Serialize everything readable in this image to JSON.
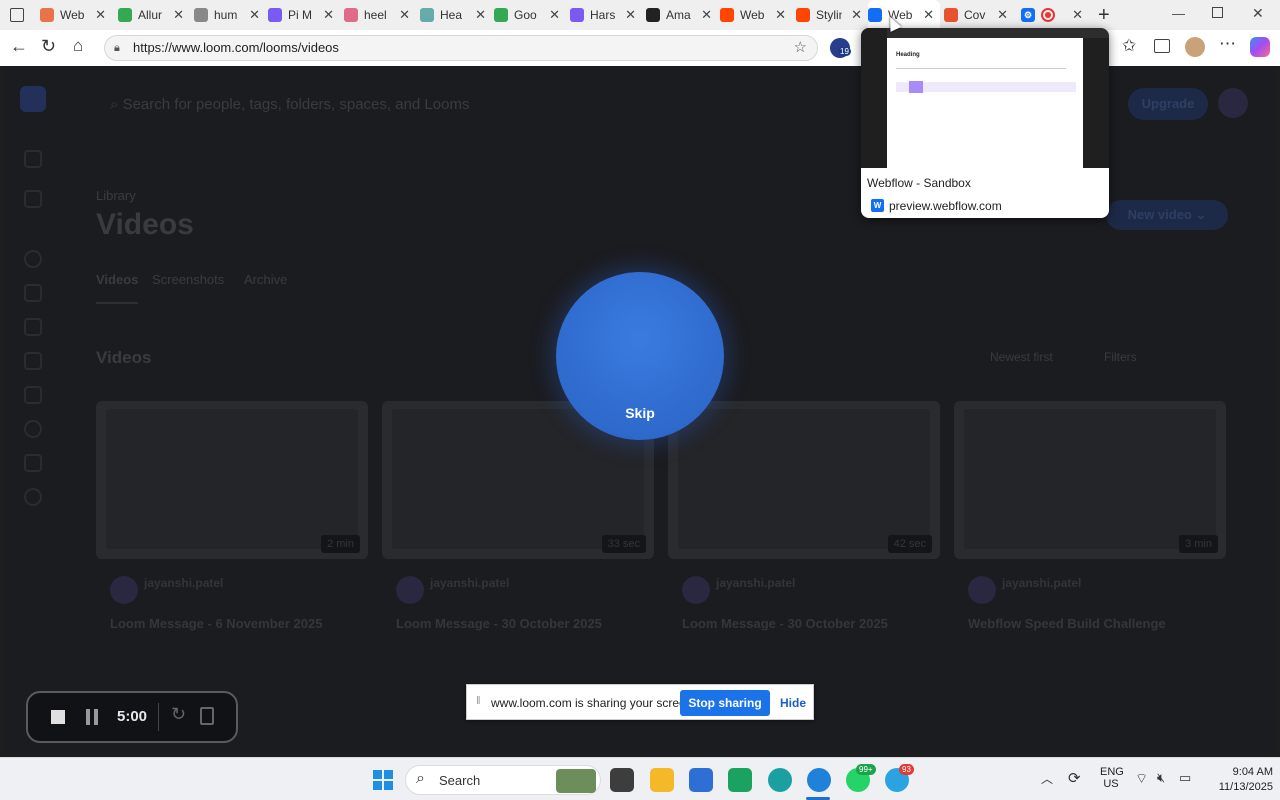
{
  "browser": {
    "tabs": [
      {
        "title": "Web",
        "color": "#e8734a"
      },
      {
        "title": "Allur",
        "color": "#34a853"
      },
      {
        "title": "hum",
        "color": "#888888"
      },
      {
        "title": "Pi M",
        "color": "#7a5af5"
      },
      {
        "title": "heel",
        "color": "#e06a8a"
      },
      {
        "title": "Hea",
        "color": "#6aa"
      },
      {
        "title": "Goo",
        "color": "#34a853"
      },
      {
        "title": "Hars",
        "color": "#7a5af5"
      },
      {
        "title": "Ama",
        "color": "#222222"
      },
      {
        "title": "Web",
        "color": "#ff4500"
      },
      {
        "title": "Stylin",
        "color": "#ff4500"
      },
      {
        "title": "Web",
        "color": "#146ef5"
      },
      {
        "title": "Cov",
        "color": "#e8532f"
      }
    ],
    "url": "https://www.loom.com/looms/videos",
    "extension_badge": "19"
  },
  "tab_preview": {
    "title": "Webflow - Sandbox",
    "domain": "preview.webflow.com",
    "thumb_heading": "Heading"
  },
  "page": {
    "breadcrumb": "Library",
    "title": "Videos",
    "tabs": [
      "Videos",
      "Screenshots",
      "Archive"
    ],
    "section_title": "Videos",
    "new_video_label": "New video",
    "upgrade_label": "Upgrade",
    "search_placeholder": "Search for people, tags, folders, spaces, and Looms",
    "sort_label": "Newest first",
    "filter_label": "Filters",
    "cards": [
      {
        "author": "jayanshi.patel",
        "title": "Loom Message - 6 November 2025",
        "duration": "2 min"
      },
      {
        "author": "jayanshi.patel",
        "title": "Loom Message - 30 October 2025",
        "duration": "33 sec"
      },
      {
        "author": "jayanshi.patel",
        "title": "Loom Message - 30 October 2025",
        "duration": "42 sec"
      },
      {
        "author": "jayanshi.patel",
        "title": "Webflow Speed Build Challenge",
        "duration": "3 min"
      }
    ]
  },
  "overlay": {
    "skip_label": "Skip",
    "timer": "5:00"
  },
  "share_bar": {
    "message": "www.loom.com is sharing your screen.",
    "stop_label": "Stop sharing",
    "hide_label": "Hide"
  },
  "taskbar": {
    "search_label": "Search",
    "whatsapp_badge": "99+",
    "telegram_badge": "93",
    "language": "ENG",
    "region": "US",
    "time": "9:04 AM",
    "date": "11/13/2025"
  }
}
